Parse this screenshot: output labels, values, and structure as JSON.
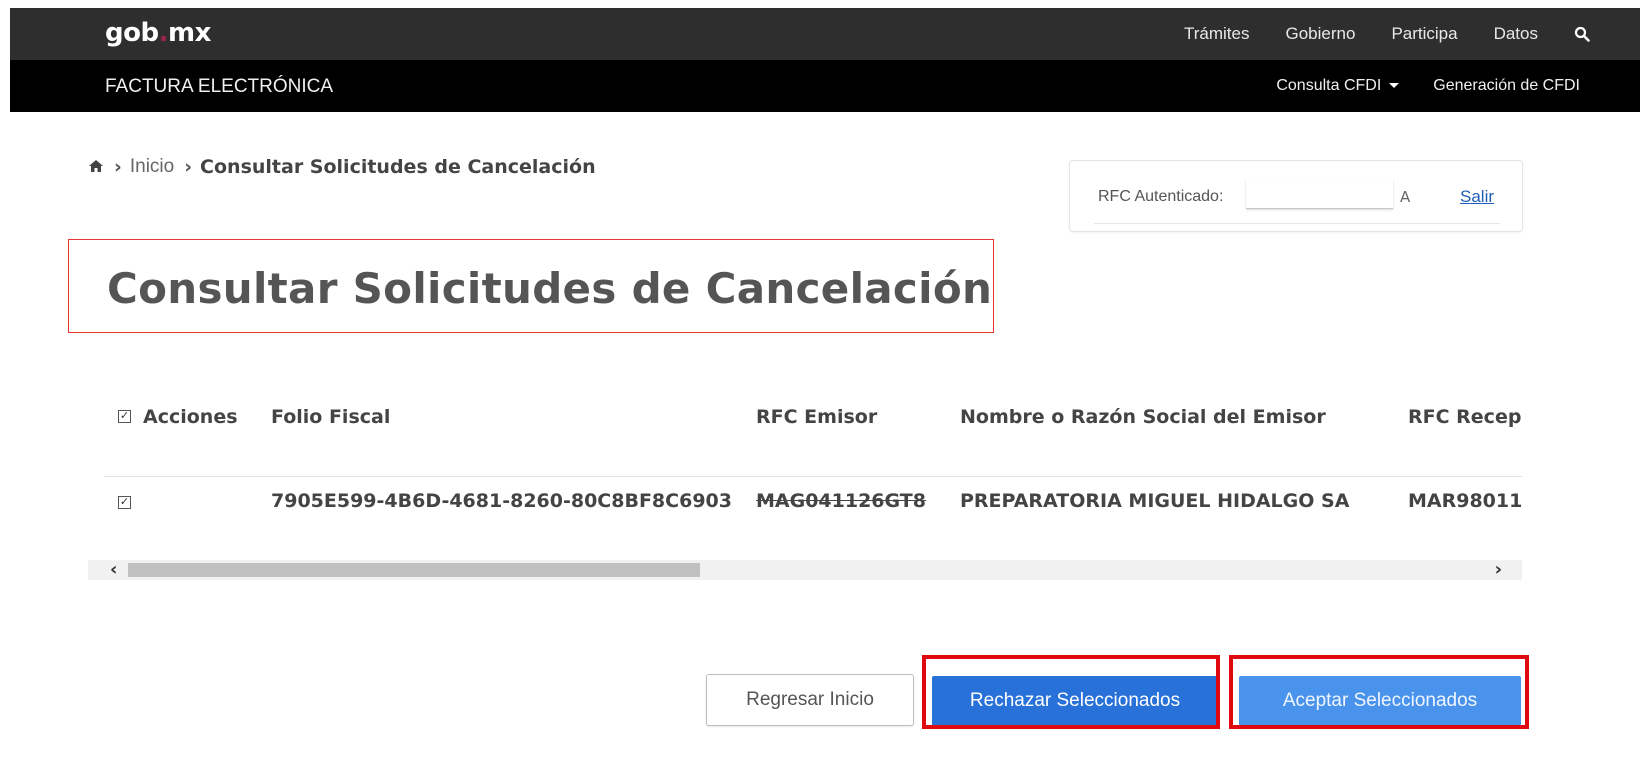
{
  "header": {
    "brand": "gob",
    "brand_dot": ".",
    "brand_suffix": "mx",
    "nav": [
      "Trámites",
      "Gobierno",
      "Participa",
      "Datos"
    ],
    "search_icon": "search-icon"
  },
  "subheader": {
    "title": "FACTURA ELECTRÓNICA",
    "nav": [
      "Consulta CFDI",
      "Generación de CFDI"
    ]
  },
  "breadcrumb": {
    "home_icon": "home-icon",
    "items": [
      "Inicio",
      "Consultar Solicitudes de Cancelación"
    ]
  },
  "rfc": {
    "label": "RFC Autenticado:",
    "value": "",
    "tail": "A",
    "logout": "Salir"
  },
  "page": {
    "title": "Consultar Solicitudes de Cancelación"
  },
  "table": {
    "columns": [
      "Acciones",
      "Folio Fiscal",
      "RFC Emisor",
      "Nombre o Razón Social del Emisor",
      "RFC Recep"
    ],
    "rows": [
      {
        "checked": true,
        "folio": "7905E599-4B6D-4681-8260-80C8BF8C6903",
        "rfc_emisor": "MAG041126GT8",
        "nombre_emisor": "PREPARATORIA MIGUEL HIDALGO SA",
        "rfc_receptor": "MAR98011"
      }
    ],
    "scroll_fraction": 0.42
  },
  "actions": {
    "back": "Regresar Inicio",
    "reject": "Rechazar Seleccionados",
    "accept": "Aceptar Seleccionados"
  },
  "colors": {
    "topbar": "#2e2e2e",
    "subbar": "#000000",
    "highlight": "#e0090f",
    "reject_button": "#2771d9",
    "accept_button": "#4a93ec"
  }
}
